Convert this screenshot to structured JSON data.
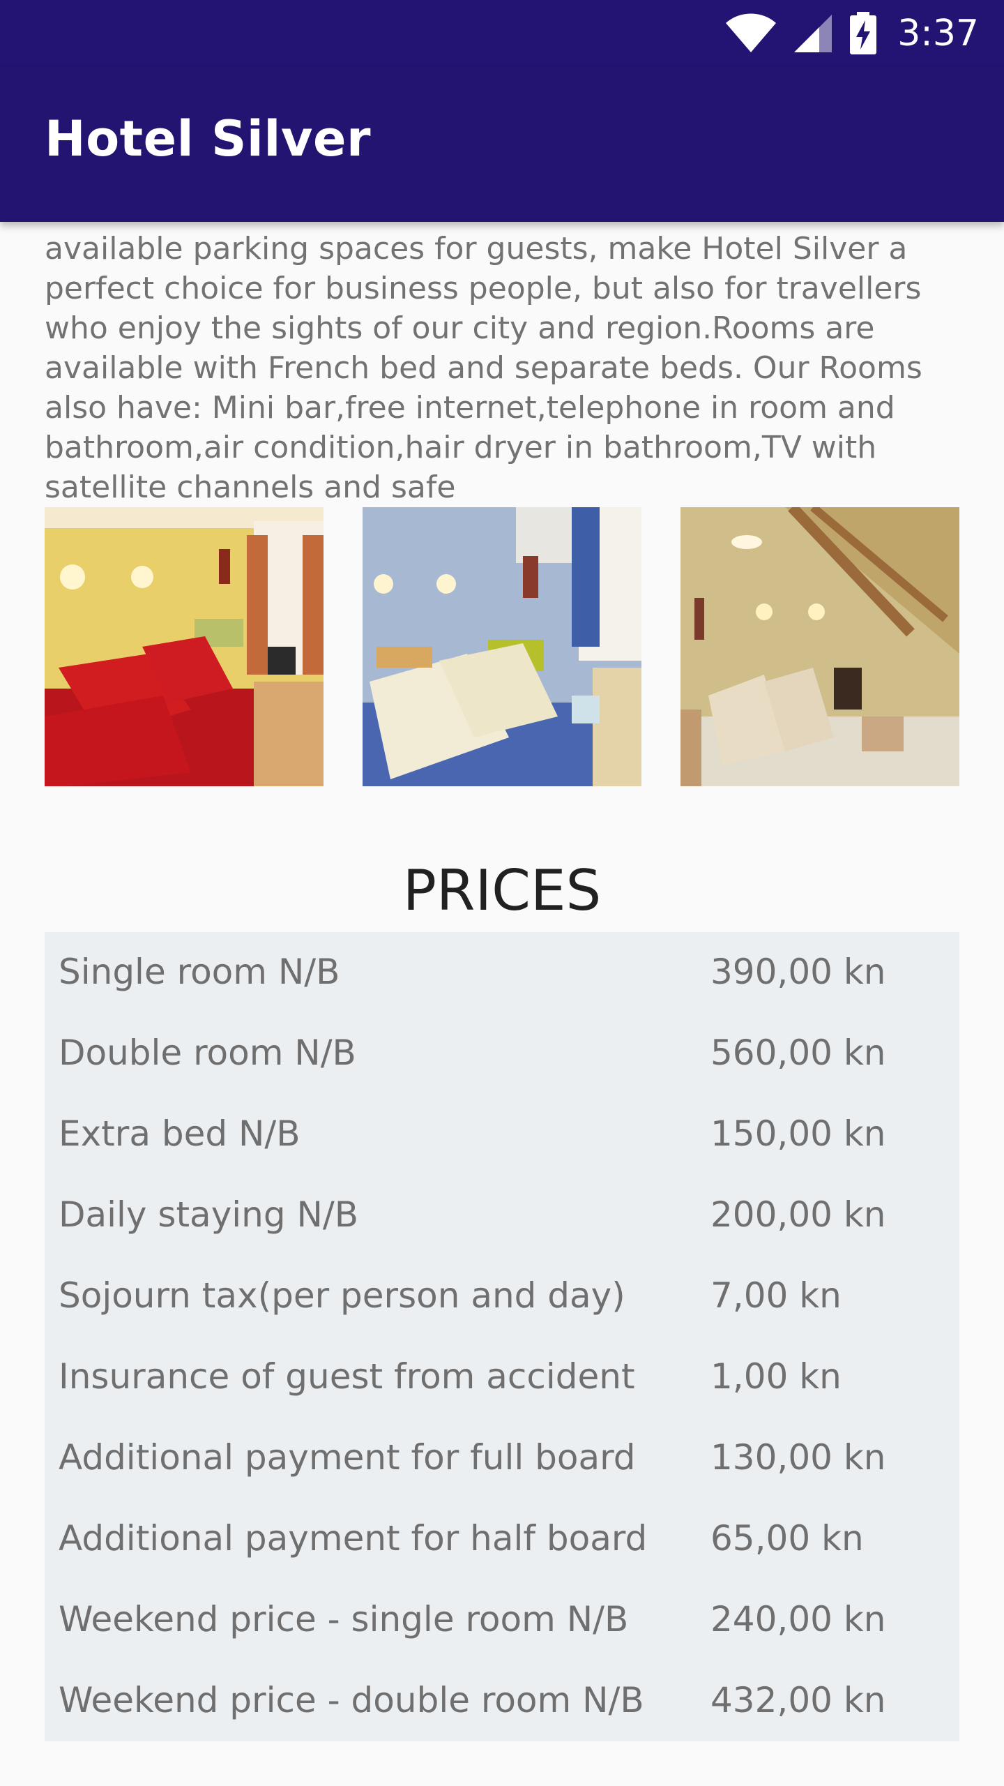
{
  "status_bar": {
    "time": "3:37",
    "icons": [
      "wifi-icon",
      "cellular-signal-icon",
      "battery-charging-icon"
    ]
  },
  "app_bar": {
    "title": "Hotel Silver"
  },
  "description": "available parking spaces for guests, make Hotel Silver a perfect choice for business people, but also for travellers who enjoy the sights of our city and region.Rooms are available with French bed and separate beds. Our Rooms also have: Mini bar,free internet,telephone in room and bathroom,air condition,hair dryer in bathroom,TV with satellite channels and safe",
  "gallery": {
    "photos": [
      "room-photo-red",
      "room-photo-blue",
      "room-photo-attic"
    ]
  },
  "prices": {
    "title": "PRICES",
    "rows": [
      {
        "label": "Single room N/B",
        "value": "390,00 kn"
      },
      {
        "label": "Double room N/B",
        "value": "560,00 kn"
      },
      {
        "label": "Extra bed N/B",
        "value": "150,00 kn"
      },
      {
        "label": "Daily staying N/B",
        "value": "200,00 kn"
      },
      {
        "label": "Sojourn tax(per person and day)",
        "value": "7,00 kn"
      },
      {
        "label": "Insurance of guest from accident",
        "value": "1,00 kn"
      },
      {
        "label": "Additional payment for full board",
        "value": "130,00 kn"
      },
      {
        "label": "Additional payment for half board",
        "value": "65,00 kn"
      },
      {
        "label": "Weekend price - single room N/B",
        "value": "240,00 kn"
      },
      {
        "label": "Weekend price - double room N/B",
        "value": "432,00 kn"
      }
    ]
  },
  "colors": {
    "primary_dark": "#231473",
    "primary": "#221470",
    "table_background": "#eceff2",
    "body_text": "#727272"
  }
}
